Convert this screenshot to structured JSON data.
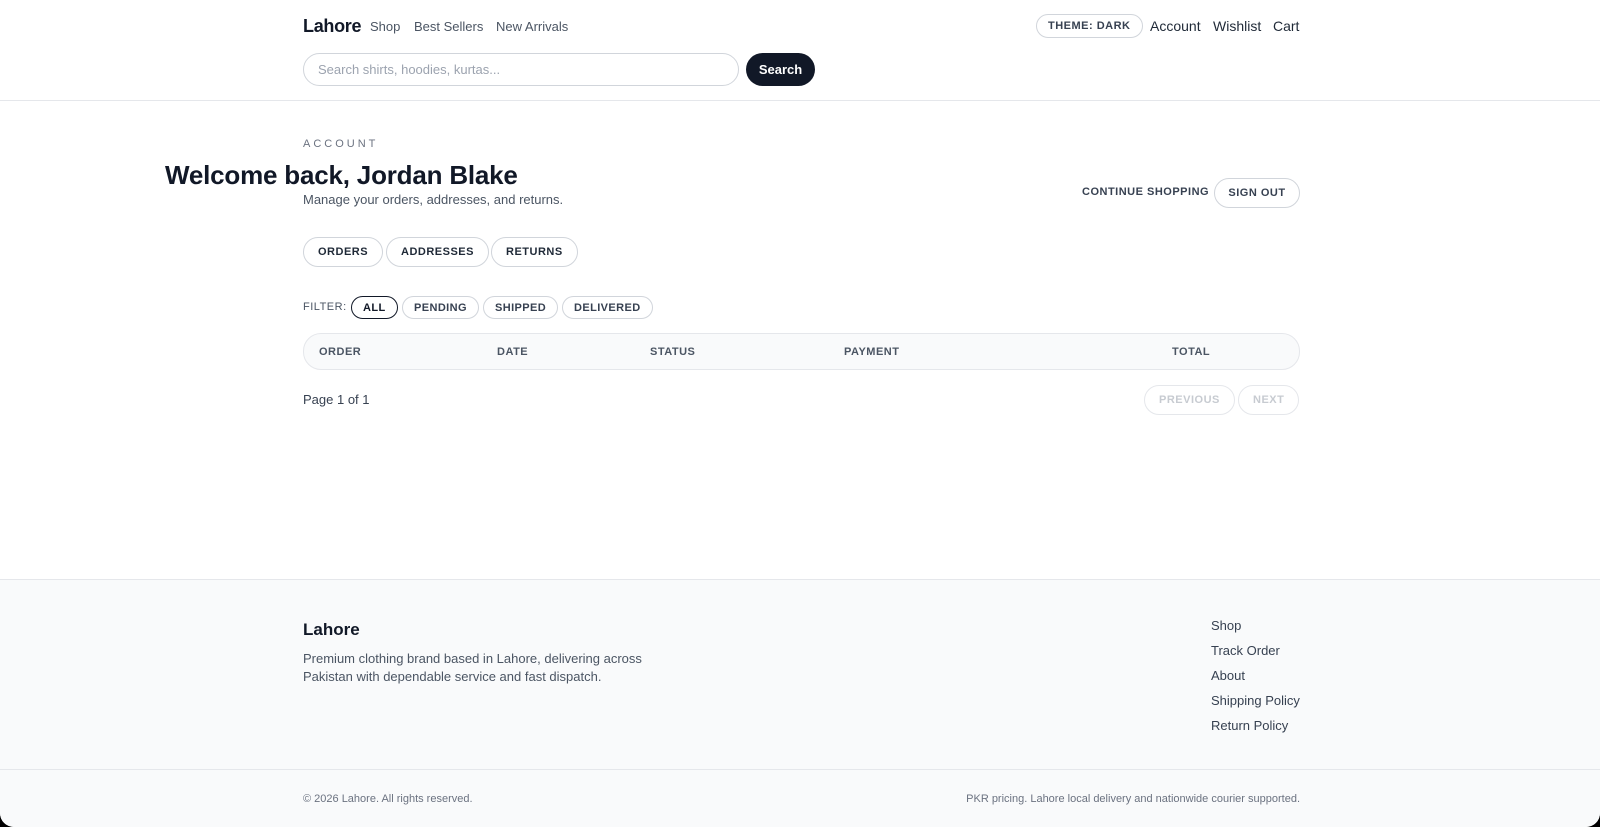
{
  "header": {
    "brand": "Lahore",
    "nav": [
      "Shop",
      "Best Sellers",
      "New Arrivals"
    ],
    "theme_toggle": "THEME: DARK",
    "account_links": [
      "Account",
      "Wishlist",
      "Cart"
    ],
    "search": {
      "placeholder": "Search shirts, hoodies, kurtas...",
      "value": "",
      "button": "Search"
    }
  },
  "main": {
    "eyebrow": "ACCOUNT",
    "welcome": "Welcome back, Jordan Blake",
    "subtitle": "Manage your orders, addresses, and returns.",
    "continue_shopping": "CONTINUE SHOPPING",
    "sign_out": "SIGN OUT",
    "tabs": [
      "ORDERS",
      "ADDRESSES",
      "RETURNS"
    ],
    "filter": {
      "label": "FILTER:",
      "options": [
        "ALL",
        "PENDING",
        "SHIPPED",
        "DELIVERED"
      ],
      "selected": "ALL"
    },
    "table": {
      "columns": [
        "ORDER",
        "DATE",
        "STATUS",
        "PAYMENT",
        "TOTAL"
      ],
      "rows": []
    },
    "pagination": {
      "info": "Page 1 of 1",
      "previous": "PREVIOUS",
      "next": "NEXT"
    }
  },
  "footer": {
    "brand": "Lahore",
    "description": "Premium clothing brand based in Lahore, delivering across Pakistan with dependable service and fast dispatch.",
    "links": [
      "Shop",
      "Track Order",
      "About",
      "Shipping Policy",
      "Return Policy"
    ],
    "copyright": "© 2026 Lahore. All rights reserved.",
    "note": "PKR pricing. Lahore local delivery and nationwide courier supported."
  }
}
